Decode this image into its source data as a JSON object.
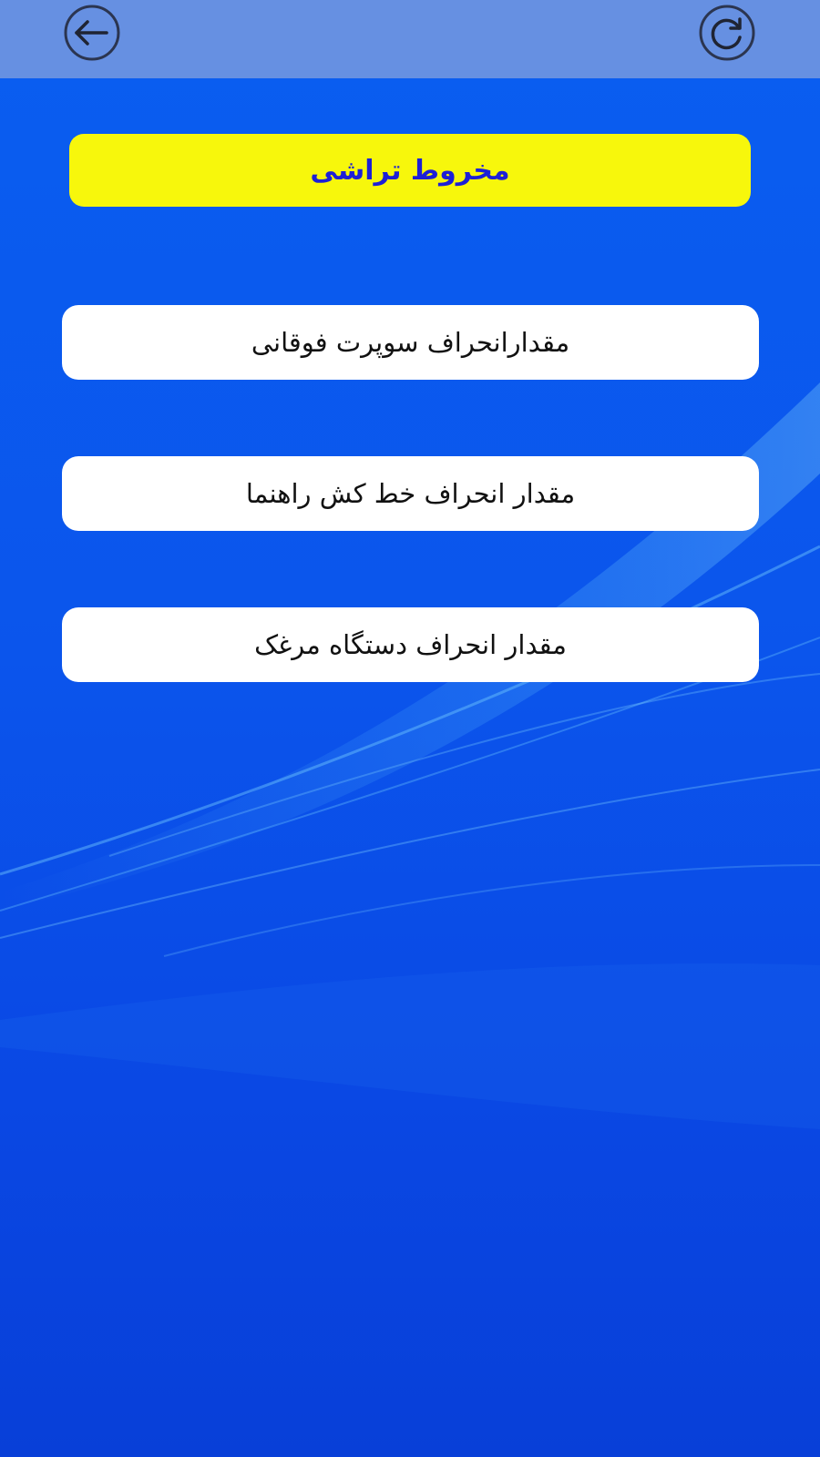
{
  "header": {
    "back_icon": "arrow-left-icon",
    "refresh_icon": "refresh-icon"
  },
  "title": "مخروط تراشی",
  "menu": [
    {
      "label": "مقدارانحراف سوپرت فوقانی"
    },
    {
      "label": "مقدار انحراف خط کش راهنما"
    },
    {
      "label": "مقدار انحراف دستگاه مرغک"
    }
  ],
  "colors": {
    "background": "#0a55ec",
    "top_bar": "#6690e2",
    "title_banner": "#f7f70c",
    "title_text": "#1d1fd6",
    "button_bg": "#ffffff",
    "button_text": "#111111"
  }
}
